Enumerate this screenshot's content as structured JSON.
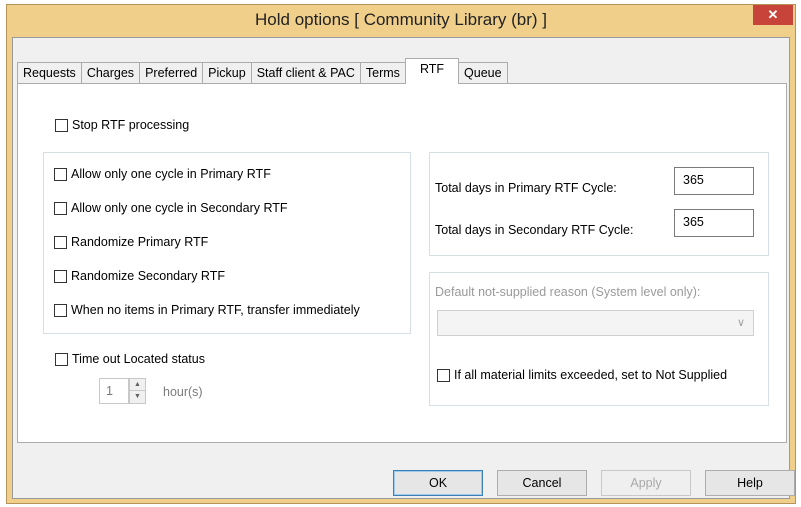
{
  "window": {
    "title": "Hold options [ Community Library  (br) ]",
    "close_glyph": "✕"
  },
  "tabs": [
    {
      "label": "Requests"
    },
    {
      "label": "Charges"
    },
    {
      "label": "Preferred"
    },
    {
      "label": "Pickup"
    },
    {
      "label": "Staff client & PAC"
    },
    {
      "label": "Terms"
    },
    {
      "label": "RTF",
      "active": true
    },
    {
      "label": "Queue"
    }
  ],
  "rtf": {
    "stop_processing_label": "Stop RTF processing",
    "stop_processing_checked": false,
    "options": [
      {
        "label": "Allow only one cycle in Primary RTF",
        "checked": false
      },
      {
        "label": "Allow only one cycle in Secondary RTF",
        "checked": false
      },
      {
        "label": "Randomize Primary RTF",
        "checked": false
      },
      {
        "label": "Randomize Secondary RTF",
        "checked": false
      },
      {
        "label": "When no items in Primary RTF, transfer immediately",
        "checked": false
      }
    ],
    "primary_days_label": "Total days in Primary RTF Cycle:",
    "primary_days_value": "365",
    "secondary_days_label": "Total days in Secondary RTF Cycle:",
    "secondary_days_value": "365",
    "not_supplied_label": "Default not-supplied reason (System level only):",
    "not_supplied_selected": "",
    "material_limits_label": "If all material limits exceeded, set to Not Supplied",
    "material_limits_checked": false,
    "timeout_label": "Time out Located status",
    "timeout_checked": false,
    "timeout_value": "1",
    "timeout_unit": "hour(s)"
  },
  "buttons": {
    "ok": "OK",
    "cancel": "Cancel",
    "apply": "Apply",
    "help": "Help"
  },
  "colors": {
    "titlebar": "#f0cf8a",
    "close_button": "#c7443a",
    "default_button_border": "#3c7fb1"
  }
}
